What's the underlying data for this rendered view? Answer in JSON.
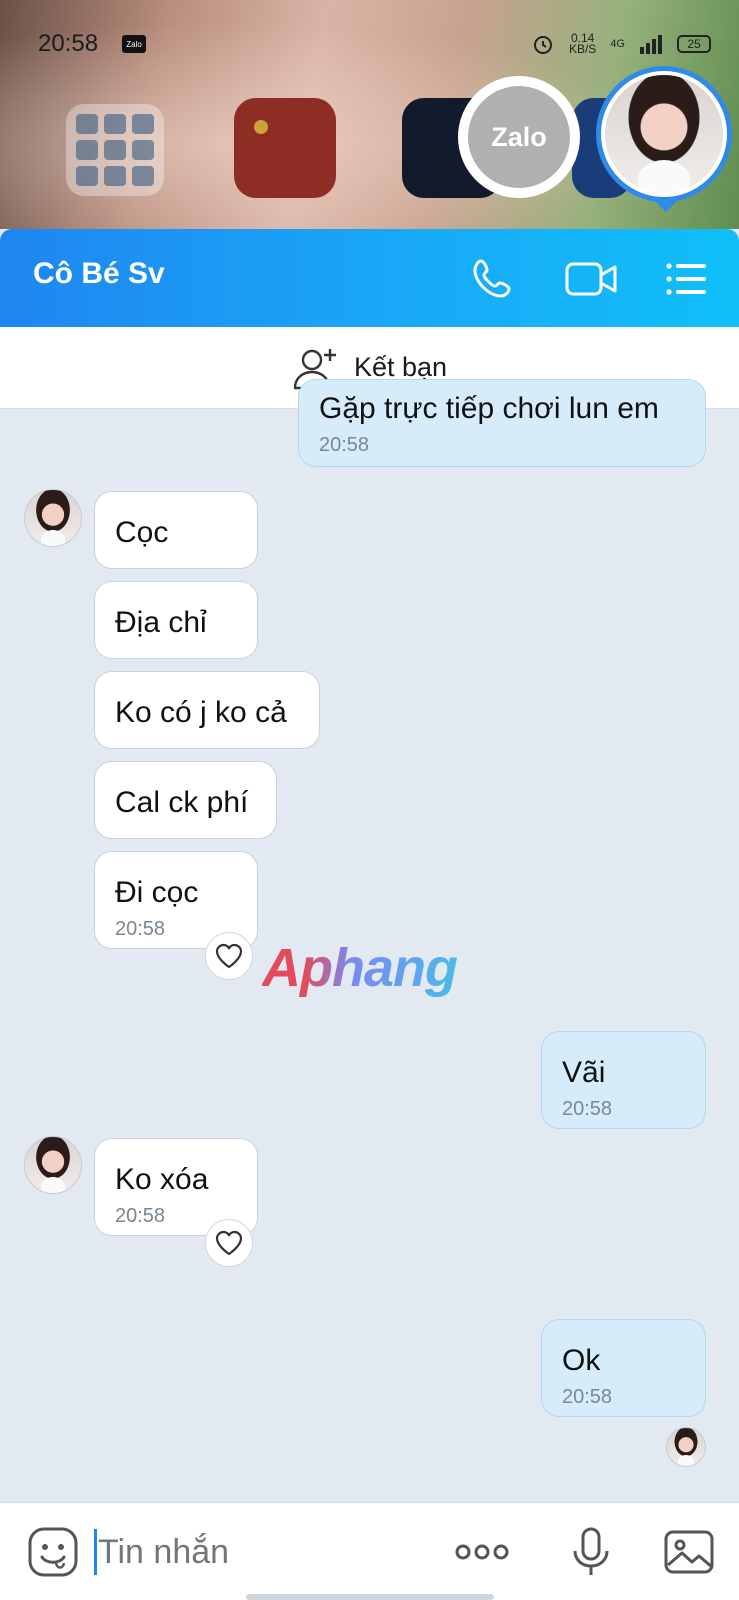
{
  "status_bar": {
    "time": "20:58",
    "notification_app": "Zalo",
    "net_speed": "0.14",
    "net_unit": "KB/S",
    "network_type": "4G",
    "battery": "25"
  },
  "floating": {
    "zalo_label": "Zalo"
  },
  "header": {
    "contact_name": "Cô Bé Sv",
    "icons": [
      "phone-icon",
      "video-call-icon",
      "menu-icon"
    ]
  },
  "friend_bar": {
    "label": "Kết bạn"
  },
  "messages": [
    {
      "dir": "out",
      "text": "Gặp trực tiếp chơi lun em",
      "time": "20:58"
    },
    {
      "dir": "in",
      "text": "Cọc"
    },
    {
      "dir": "in",
      "text": "Địa chỉ"
    },
    {
      "dir": "in",
      "text": "Ko có j ko cả"
    },
    {
      "dir": "in",
      "text": "Cal ck phí"
    },
    {
      "dir": "in",
      "text": "Đi cọc",
      "time": "20:58"
    },
    {
      "dir": "out",
      "text": "Vãi",
      "time": "20:58"
    },
    {
      "dir": "in",
      "text": "Ko xóa",
      "time": "20:58"
    },
    {
      "dir": "out",
      "text": "Ok",
      "time": "20:58"
    }
  ],
  "watermark": "Aphang",
  "input": {
    "placeholder": "Tin nhắn",
    "icons": [
      "sticker-icon",
      "more-icon",
      "microphone-icon",
      "image-icon"
    ]
  },
  "colors": {
    "header_start": "#1f86f0",
    "header_end": "#10bff8",
    "chat_bg": "#e2e9f1",
    "outgoing_bubble": "#d6ecfb",
    "incoming_bubble": "#ffffff"
  }
}
